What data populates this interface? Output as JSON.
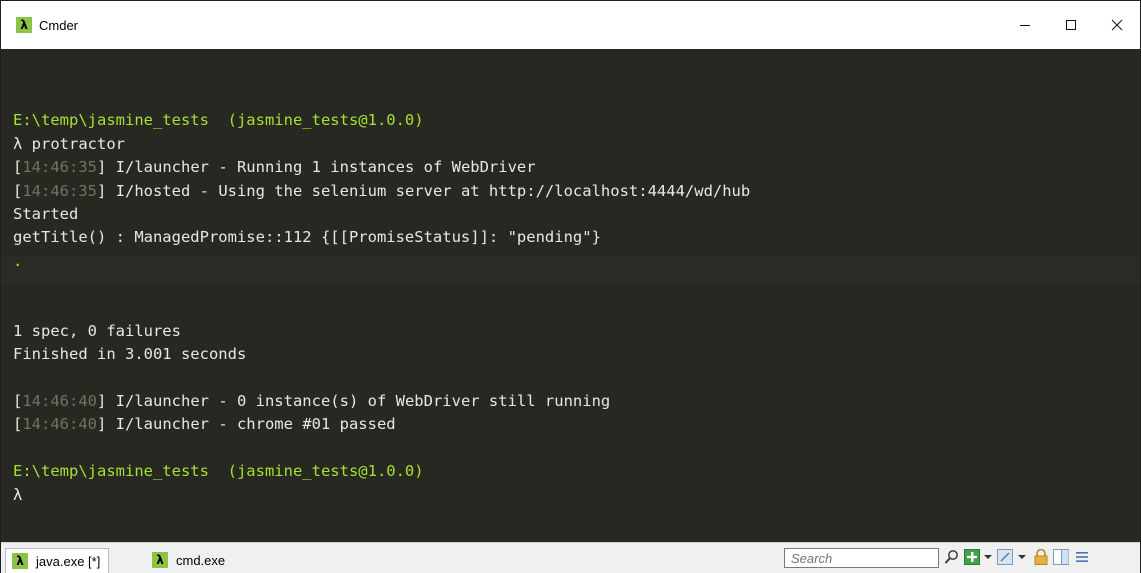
{
  "window": {
    "title": "Cmder"
  },
  "console": {
    "lines": [
      {
        "parts": [
          {
            "text": "",
            "kind": "plain"
          }
        ]
      },
      {
        "parts": [
          {
            "text": "E:\\temp\\jasmine_tests  (jasmine_tests@1.0.0)",
            "kind": "prompt"
          }
        ]
      },
      {
        "parts": [
          {
            "text": "λ protractor",
            "kind": "plain"
          }
        ]
      },
      {
        "parts": [
          {
            "text": "[",
            "kind": "plain"
          },
          {
            "text": "14:46:35",
            "kind": "ts"
          },
          {
            "text": "] I/launcher - Running 1 instances of WebDriver",
            "kind": "plain"
          }
        ]
      },
      {
        "parts": [
          {
            "text": "[",
            "kind": "plain"
          },
          {
            "text": "14:46:35",
            "kind": "ts"
          },
          {
            "text": "] I/hosted - Using the selenium server at http://localhost:4444/wd/hub",
            "kind": "plain"
          }
        ]
      },
      {
        "parts": [
          {
            "text": "Started",
            "kind": "plain"
          }
        ]
      },
      {
        "parts": [
          {
            "text": "getTitle() : ManagedPromise::112 {[[PromiseStatus]]: \"pending\"}",
            "kind": "plain"
          }
        ]
      },
      {
        "parts": [
          {
            "text": ".",
            "kind": "dot"
          }
        ]
      },
      {
        "parts": [
          {
            "text": "",
            "kind": "plain"
          }
        ]
      },
      {
        "parts": [
          {
            "text": "",
            "kind": "plain"
          }
        ]
      },
      {
        "parts": [
          {
            "text": "1 spec, 0 failures",
            "kind": "plain"
          }
        ]
      },
      {
        "parts": [
          {
            "text": "Finished in 3.001 seconds",
            "kind": "plain"
          }
        ]
      },
      {
        "parts": [
          {
            "text": "",
            "kind": "plain"
          }
        ]
      },
      {
        "parts": [
          {
            "text": "[",
            "kind": "plain"
          },
          {
            "text": "14:46:40",
            "kind": "ts"
          },
          {
            "text": "] I/launcher - 0 instance(s) of WebDriver still running",
            "kind": "plain"
          }
        ]
      },
      {
        "parts": [
          {
            "text": "[",
            "kind": "plain"
          },
          {
            "text": "14:46:40",
            "kind": "ts"
          },
          {
            "text": "] I/launcher - chrome #01 passed",
            "kind": "plain"
          }
        ]
      },
      {
        "parts": [
          {
            "text": "",
            "kind": "plain"
          }
        ]
      },
      {
        "parts": [
          {
            "text": "E:\\temp\\jasmine_tests  (jasmine_tests@1.0.0)",
            "kind": "prompt"
          }
        ]
      },
      {
        "parts": [
          {
            "text": "λ",
            "kind": "plain"
          }
        ]
      }
    ]
  },
  "statusbar": {
    "tabs": [
      {
        "icon": "lambda-icon",
        "label": "java.exe [*]",
        "active": true
      },
      {
        "icon": "lambda-icon",
        "label": "cmd.exe",
        "active": false
      }
    ],
    "search": {
      "placeholder": "Search",
      "value": ""
    },
    "icons": [
      "search-icon",
      "new-console-icon",
      "dropdown-icon",
      "restore-icon",
      "dropdown-icon",
      "lock-icon",
      "split-view-icon",
      "menu-icon"
    ]
  },
  "colors": {
    "console_bg": "#272822",
    "prompt": "#a6e22e",
    "timestamp": "#75715e",
    "text": "#e8e8e2",
    "accent_icon": "#8bc34a"
  },
  "app_icon": {
    "glyph": "λ"
  }
}
